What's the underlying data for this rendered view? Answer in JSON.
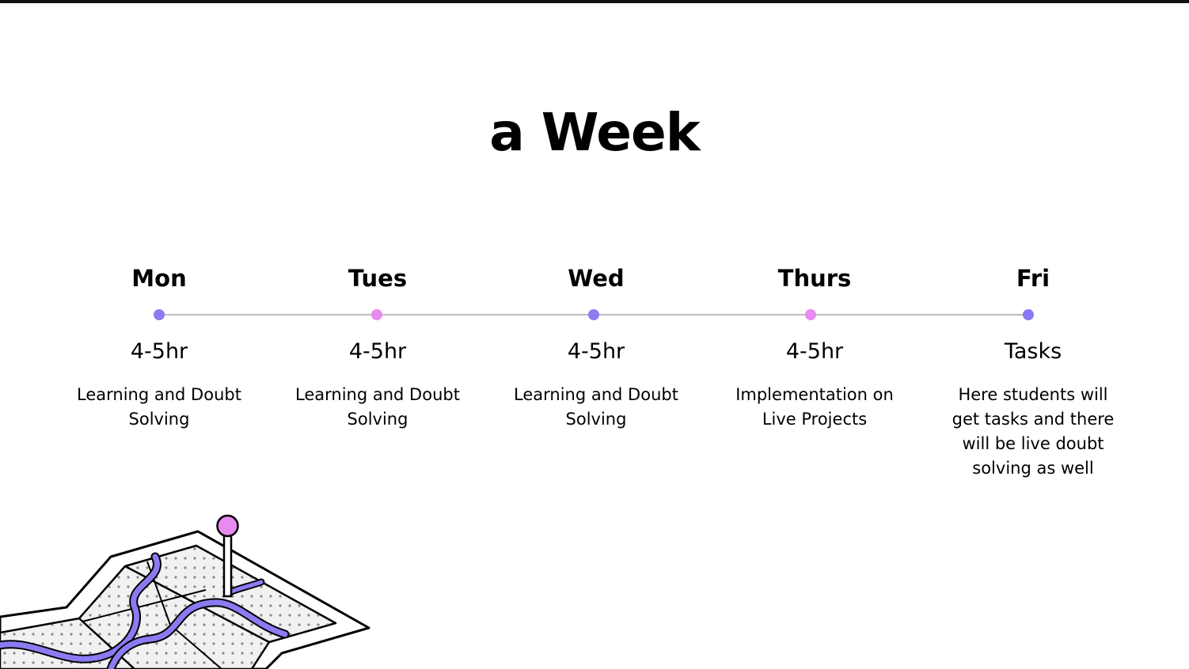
{
  "slide": {
    "title": "a Week"
  },
  "colors": {
    "purple": "#8b7bf3",
    "pink": "#e98af0",
    "line": "#bdbbbf"
  },
  "schedule": [
    {
      "day": "Mon",
      "hours": "4-5hr",
      "description": "Learning and Doubt Solving",
      "dot_color": "purple"
    },
    {
      "day": "Tues",
      "hours": "4-5hr",
      "description": "Learning and Doubt Solving",
      "dot_color": "pink"
    },
    {
      "day": "Wed",
      "hours": "4-5hr",
      "description": "Learning and Doubt Solving",
      "dot_color": "purple"
    },
    {
      "day": "Thurs",
      "hours": "4-5hr",
      "description": "Implementation on Live Projects",
      "dot_color": "pink"
    },
    {
      "day": "Fri",
      "hours": "Tasks",
      "description": "Here students will get tasks and there will be live doubt solving as well",
      "dot_color": "purple"
    }
  ],
  "illustration": {
    "icon": "map-pin-illustration"
  }
}
